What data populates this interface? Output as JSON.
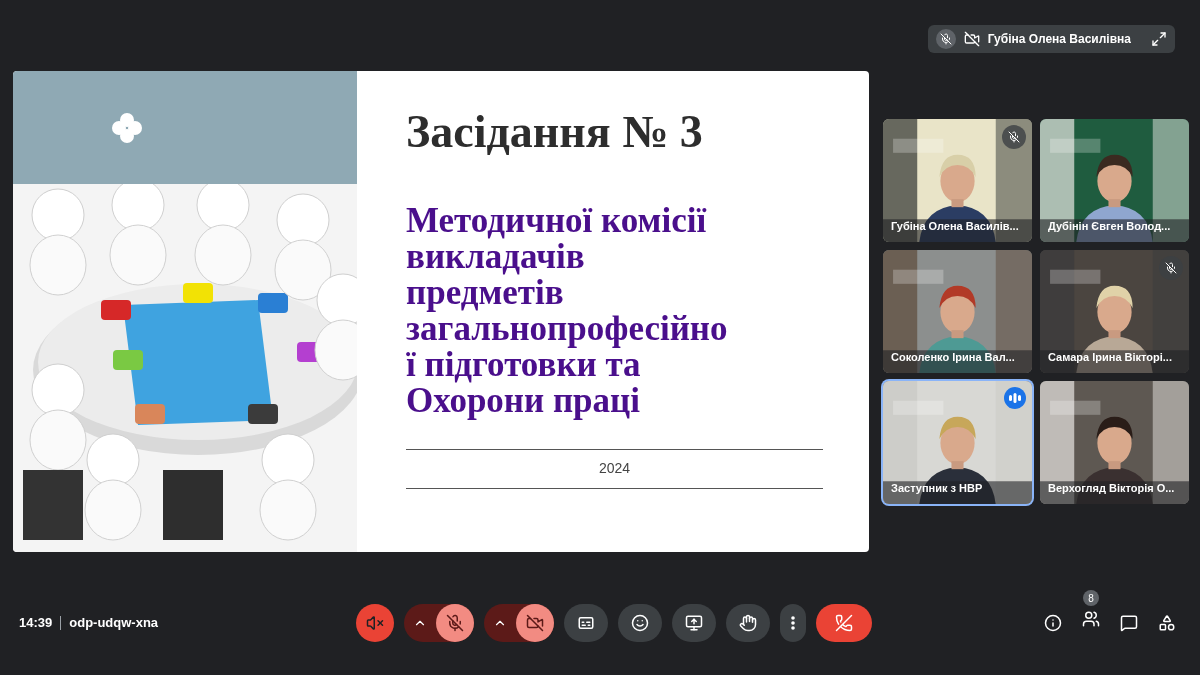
{
  "pinned": {
    "name": "Губіна Олена Василівна",
    "mic_muted": true,
    "camera_off": true
  },
  "slide": {
    "title": "Засідання № 3",
    "subtitle_lines": [
      "Методичної комісії",
      "викладачів",
      "предметів",
      "загальнопрофесійно",
      "ї підготовки та",
      "Охорони праці"
    ],
    "year": "2024"
  },
  "tiles": [
    {
      "name": "Губіна Олена Василів...",
      "muted": true,
      "speaking": false
    },
    {
      "name": "Дубінін Євген Волод...",
      "muted": false,
      "speaking": false
    },
    {
      "name": "Соколенко Ірина Вал...",
      "muted": false,
      "speaking": false
    },
    {
      "name": "Самара Ірина Вікторі...",
      "muted": true,
      "speaking": false
    },
    {
      "name": "Заступник з НВР",
      "muted": false,
      "speaking": true
    },
    {
      "name": "Верхогляд Вікторія О...",
      "muted": false,
      "speaking": false
    }
  ],
  "meeting": {
    "time": "14:39",
    "code": "odp-udqw-xna"
  },
  "controls": [
    {
      "kind": "speaker",
      "muted": true
    },
    {
      "kind": "mic",
      "muted": true
    },
    {
      "kind": "camera",
      "muted": true
    },
    {
      "kind": "captions"
    },
    {
      "kind": "emoji"
    },
    {
      "kind": "present"
    },
    {
      "kind": "hand"
    },
    {
      "kind": "more"
    },
    {
      "kind": "leave"
    }
  ],
  "side": {
    "people_count": "8"
  }
}
